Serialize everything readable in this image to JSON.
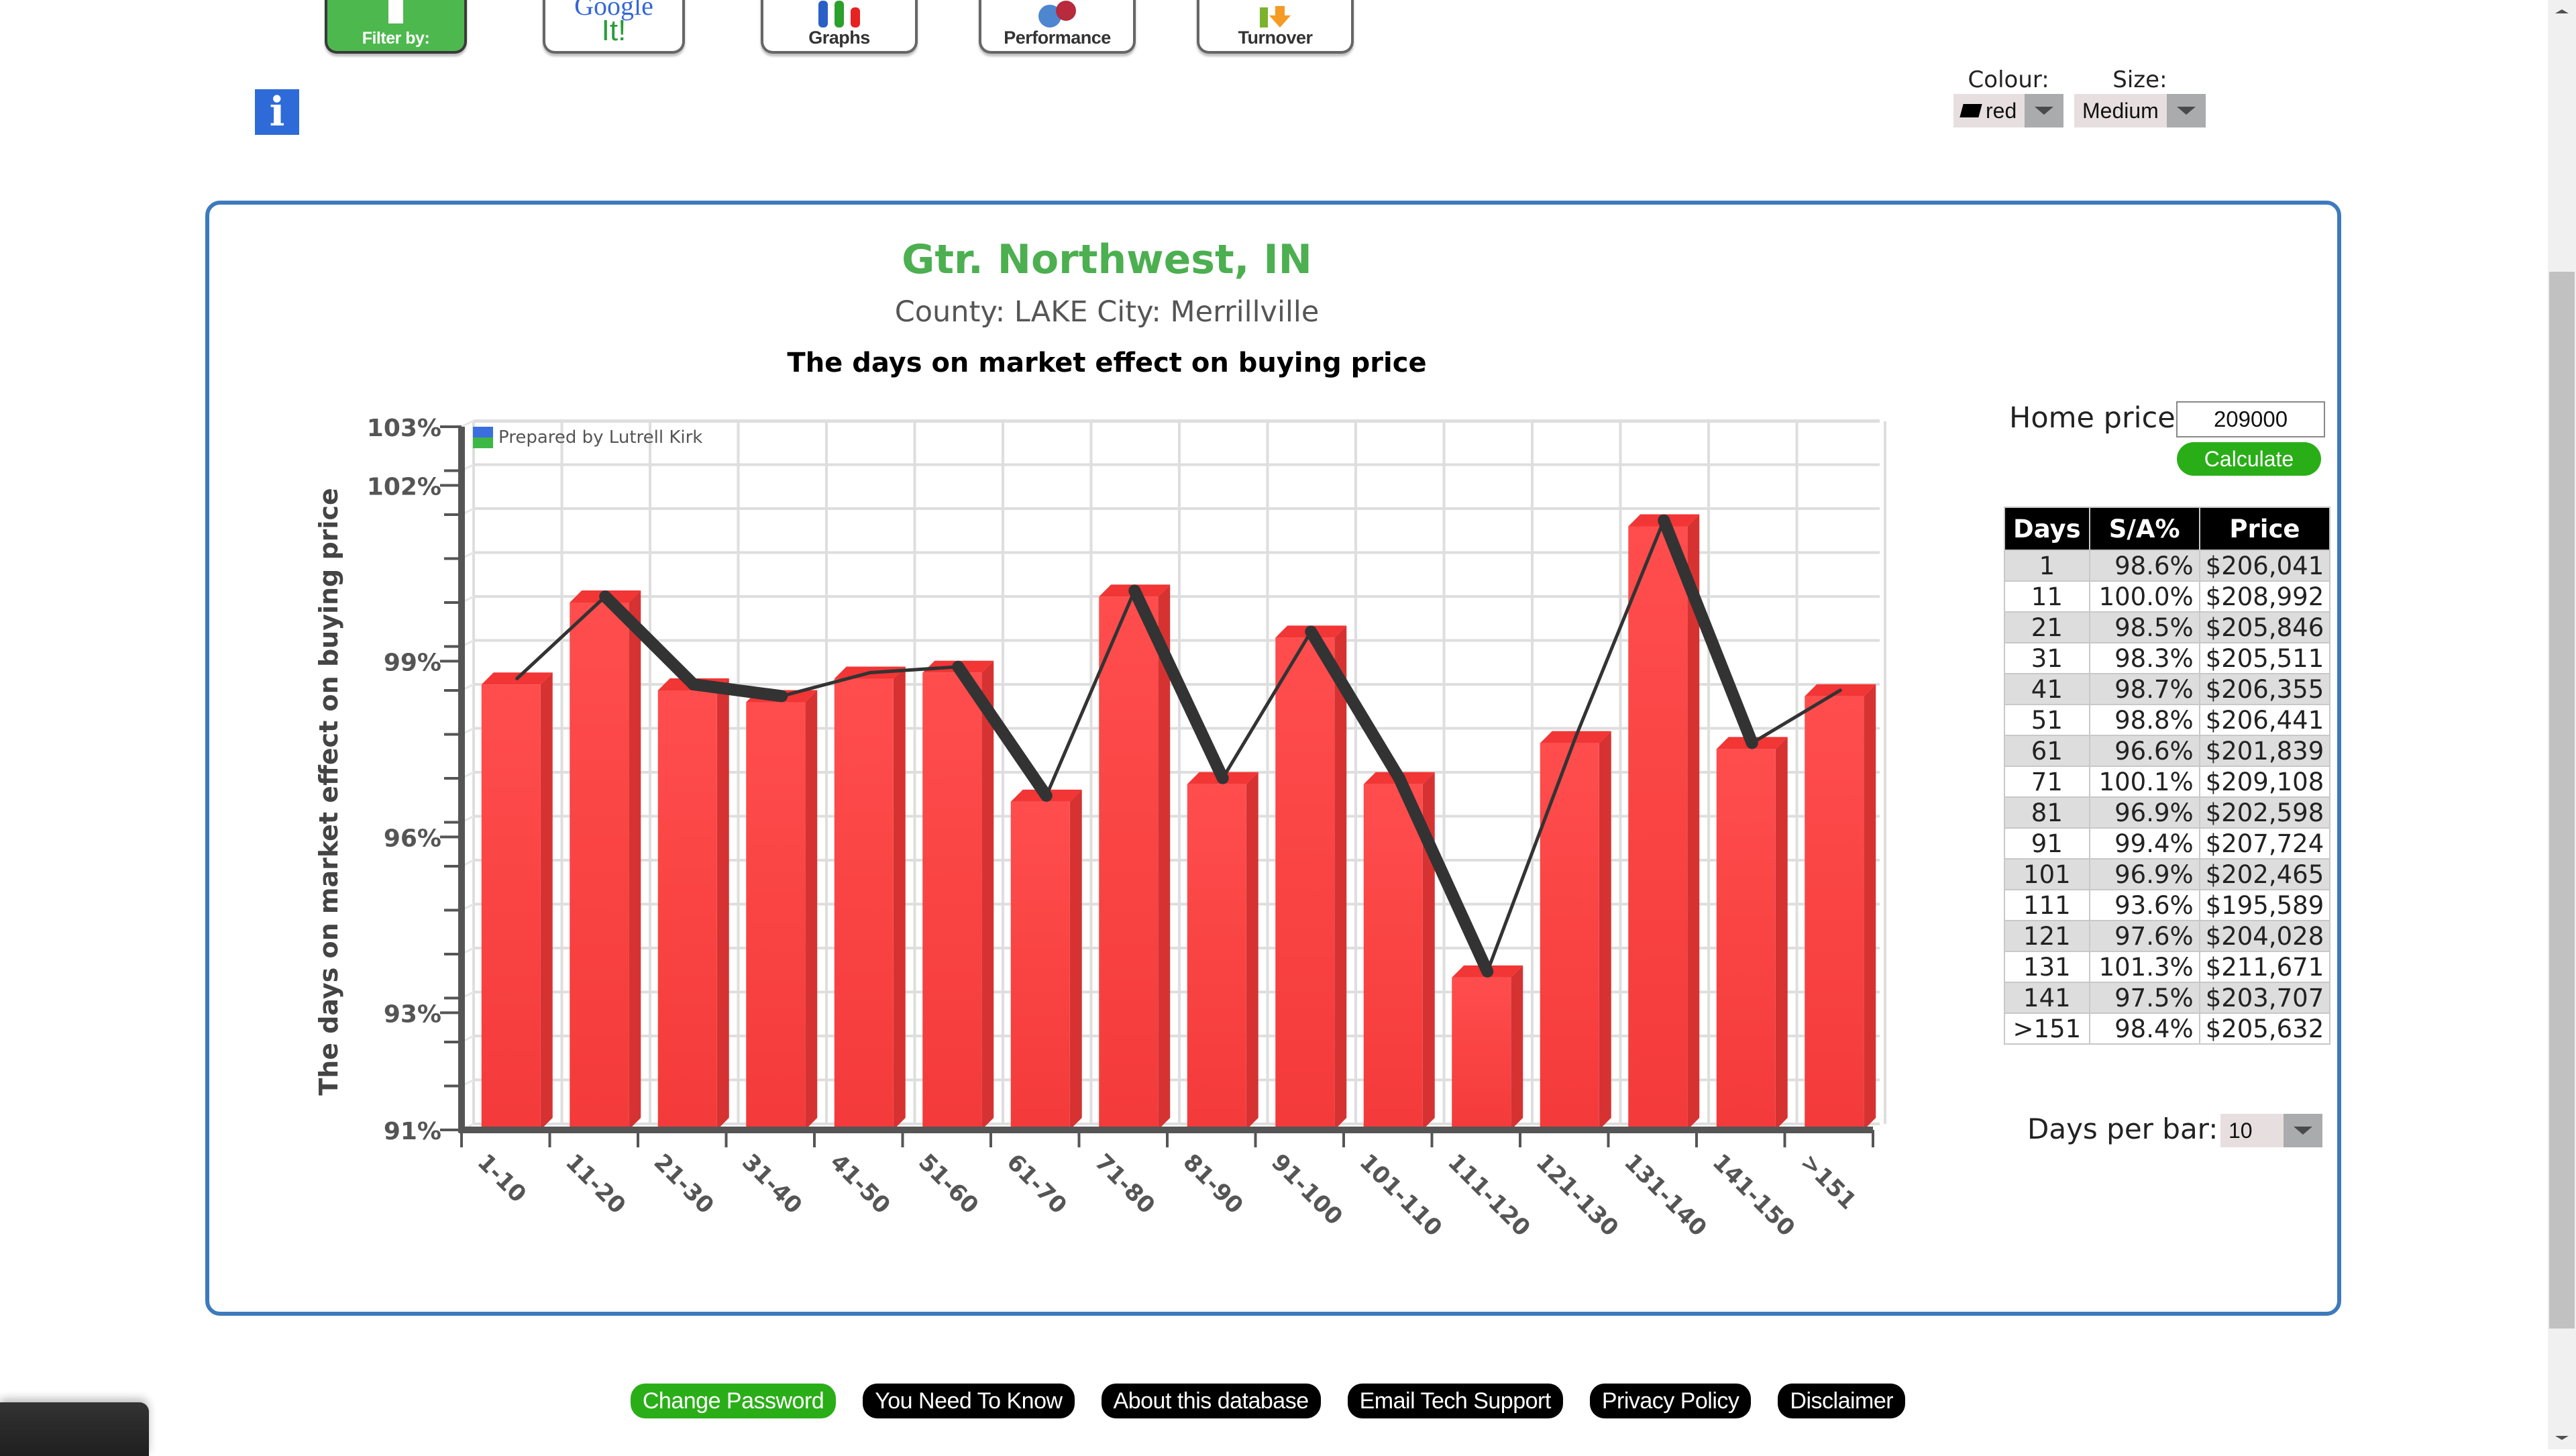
{
  "nav": {
    "buttons": [
      {
        "label": "Filter by:",
        "icon": "filter-icon"
      },
      {
        "label": "Google It!",
        "icon": "google-icon"
      },
      {
        "label": "Graphs",
        "icon": "graphs-icon"
      },
      {
        "label": "Performance",
        "icon": "performance-icon"
      },
      {
        "label": "Turnover",
        "icon": "turnover-icon"
      }
    ],
    "google_text": "Google",
    "google_it": "It!",
    "info_glyph": "i"
  },
  "options": {
    "colour_label": "Colour:",
    "colour_value": "red",
    "size_label": "Size:",
    "size_value": "Medium"
  },
  "header": {
    "title": "Gtr. Northwest, IN",
    "subtitle": "County: LAKE City: Merrillville",
    "chart_heading": "The days on market effect on buying price"
  },
  "watermark": "Prepared by Lutrell Kirk",
  "colors": {
    "bar": "#f43a3a",
    "bar_side": "#d73232",
    "bar_top": "#f23535",
    "line": "#333333",
    "title": "#4caf50",
    "frame": "#3d7abd",
    "button_green": "#2aae18"
  },
  "chart_data": {
    "type": "bar",
    "title": "The days on market effect on buying price",
    "xlabel": "",
    "ylabel": "The days on market effect on buying price",
    "ylim": [
      91,
      103
    ],
    "y_tick_labels": [
      {
        "value": 91,
        "label": "91%"
      },
      {
        "value": 93,
        "label": "93%"
      },
      {
        "value": 96,
        "label": "96%"
      },
      {
        "value": 99,
        "label": "99%"
      },
      {
        "value": 102,
        "label": "102%"
      },
      {
        "value": 103,
        "label": "103%"
      }
    ],
    "y_minor_step": 0.75,
    "grid": true,
    "categories": [
      "1-10",
      "11-20",
      "21-30",
      "31-40",
      "41-50",
      "51-60",
      "61-70",
      "71-80",
      "81-90",
      "91-100",
      "101-110",
      "111-120",
      "121-130",
      "131-140",
      "141-150",
      ">151"
    ],
    "series": [
      {
        "name": "S/A% (bars)",
        "type": "bar",
        "values": [
          98.6,
          100.0,
          98.5,
          98.3,
          98.7,
          98.8,
          96.6,
          100.1,
          96.9,
          99.4,
          96.9,
          93.6,
          97.6,
          101.3,
          97.5,
          98.4
        ]
      },
      {
        "name": "S/A% (trend line)",
        "type": "line",
        "values": [
          98.6,
          100.0,
          98.5,
          98.3,
          98.7,
          98.8,
          96.6,
          100.1,
          96.9,
          99.4,
          96.9,
          93.6,
          97.6,
          101.3,
          97.5,
          98.4
        ]
      }
    ]
  },
  "calculator": {
    "home_price_label": "Home price:",
    "home_price_value": "209000",
    "calculate_label": "Calculate"
  },
  "results_table": {
    "headers": [
      "Days",
      "S/A%",
      "Price"
    ],
    "rows": [
      [
        "1",
        "98.6%",
        "$206,041"
      ],
      [
        "11",
        "100.0%",
        "$208,992"
      ],
      [
        "21",
        "98.5%",
        "$205,846"
      ],
      [
        "31",
        "98.3%",
        "$205,511"
      ],
      [
        "41",
        "98.7%",
        "$206,355"
      ],
      [
        "51",
        "98.8%",
        "$206,441"
      ],
      [
        "61",
        "96.6%",
        "$201,839"
      ],
      [
        "71",
        "100.1%",
        "$209,108"
      ],
      [
        "81",
        "96.9%",
        "$202,598"
      ],
      [
        "91",
        "99.4%",
        "$207,724"
      ],
      [
        "101",
        "96.9%",
        "$202,465"
      ],
      [
        "111",
        "93.6%",
        "$195,589"
      ],
      [
        "121",
        "97.6%",
        "$204,028"
      ],
      [
        "131",
        "101.3%",
        "$211,671"
      ],
      [
        "141",
        "97.5%",
        "$203,707"
      ],
      [
        ">151",
        "98.4%",
        "$205,632"
      ]
    ]
  },
  "days_per_bar": {
    "label": "Days per bar:",
    "value": "10"
  },
  "footer": {
    "links": [
      "Change Password",
      "You Need To Know",
      "About this database",
      "Email Tech Support",
      "Privacy Policy",
      "Disclaimer"
    ]
  }
}
